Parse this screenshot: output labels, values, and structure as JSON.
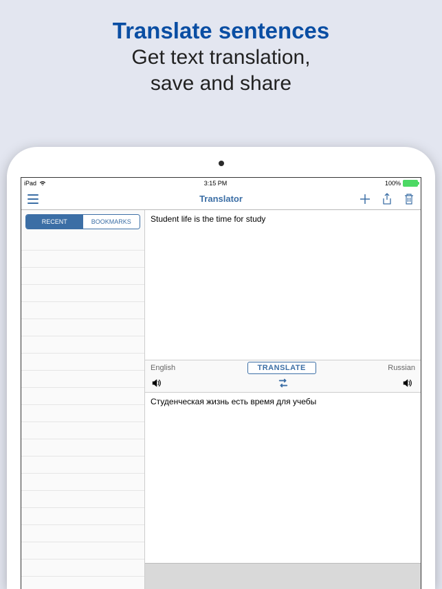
{
  "promo": {
    "title": "Translate sentences",
    "sub1": "Get text translation,",
    "sub2": "save and share"
  },
  "status": {
    "carrier": "iPad",
    "time": "3:15 PM",
    "battery": "100%"
  },
  "nav": {
    "title": "Translator"
  },
  "tabs": {
    "recent": "RECENT",
    "bookmarks": "BOOKMARKS"
  },
  "translator": {
    "input_text": "Student life is the time for study",
    "source_lang": "English",
    "target_lang": "Russian",
    "translate_label": "TRANSLATE",
    "output_text": "Студенческая жизнь есть время для учебы"
  }
}
